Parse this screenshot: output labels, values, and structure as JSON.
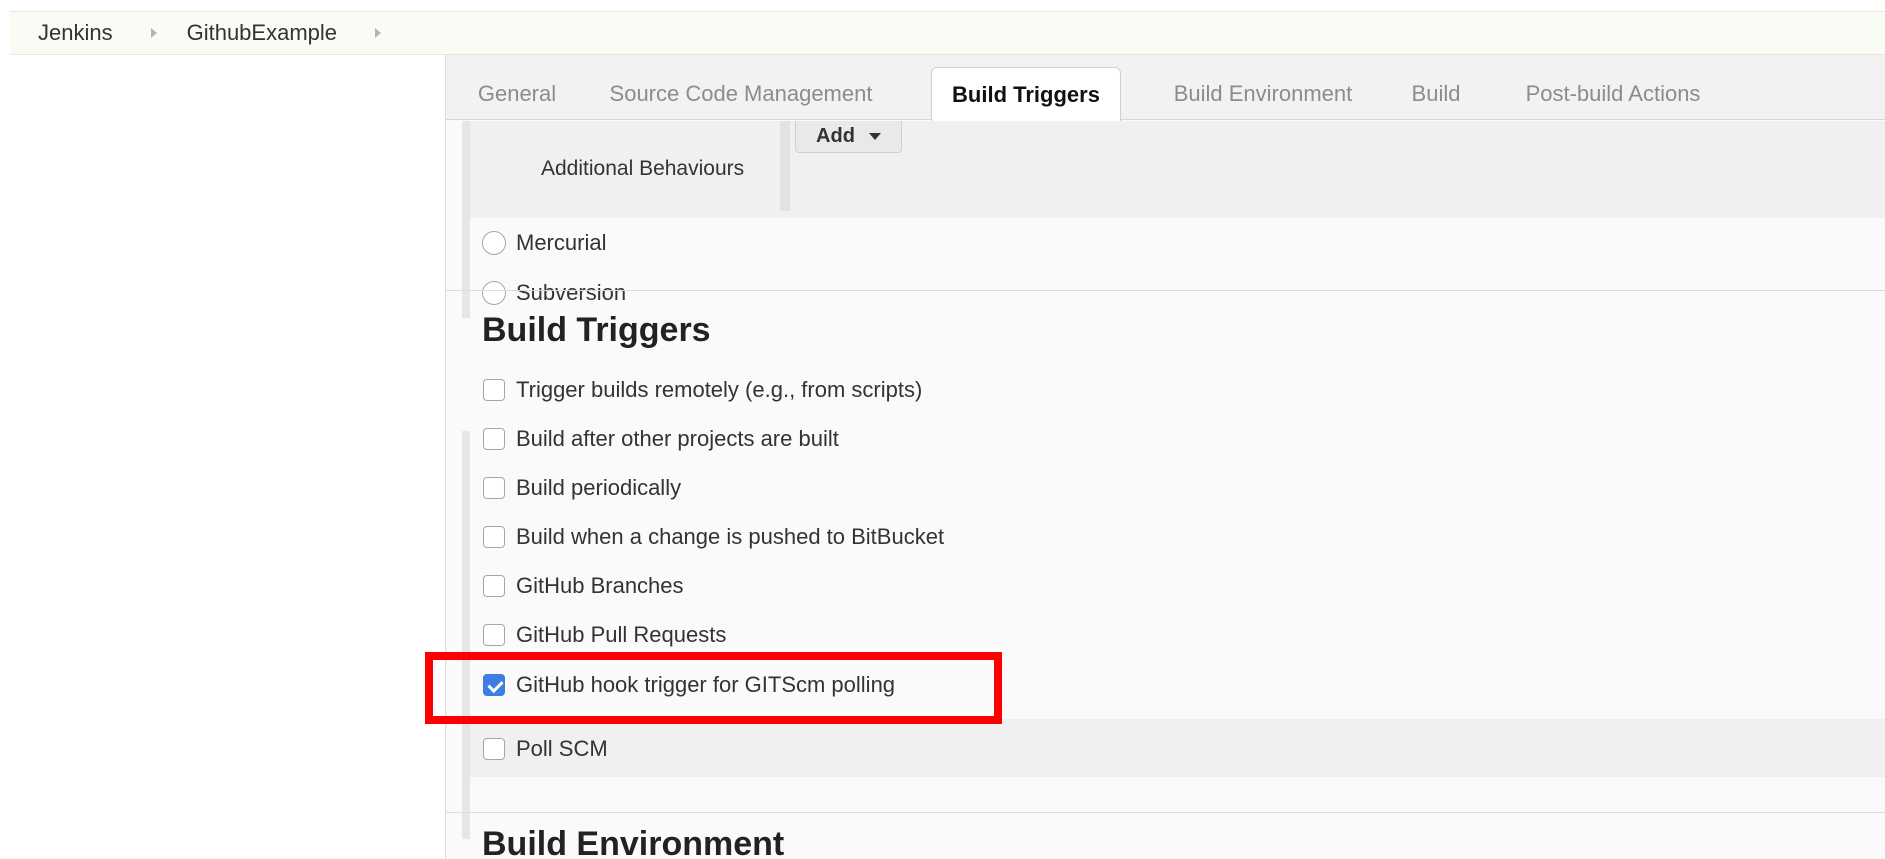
{
  "breadcrumb": {
    "items": [
      "Jenkins",
      "GithubExample"
    ]
  },
  "tabs": [
    {
      "label": "General",
      "active": false
    },
    {
      "label": "Source Code Management",
      "active": false
    },
    {
      "label": "Build Triggers",
      "active": true
    },
    {
      "label": "Build Environment",
      "active": false
    },
    {
      "label": "Build",
      "active": false
    },
    {
      "label": "Post-build Actions",
      "active": false
    }
  ],
  "scm": {
    "additional_behaviours_label": "Additional Behaviours",
    "add_button_label": "Add",
    "options": [
      {
        "label": "Mercurial",
        "selected": false
      },
      {
        "label": "Subversion",
        "selected": false
      }
    ]
  },
  "build_triggers": {
    "title": "Build Triggers",
    "options": [
      {
        "label": "Trigger builds remotely (e.g., from scripts)",
        "checked": false
      },
      {
        "label": "Build after other projects are built",
        "checked": false
      },
      {
        "label": "Build periodically",
        "checked": false
      },
      {
        "label": "Build when a change is pushed to BitBucket",
        "checked": false
      },
      {
        "label": "GitHub Branches",
        "checked": false
      },
      {
        "label": "GitHub Pull Requests",
        "checked": false
      },
      {
        "label": "GitHub hook trigger for GITScm polling",
        "checked": true
      },
      {
        "label": "Poll SCM",
        "checked": false
      }
    ]
  },
  "build_environment": {
    "title": "Build Environment"
  },
  "colors": {
    "highlight": "#ff0000",
    "checkbox_checked": "#3d7ee0"
  }
}
